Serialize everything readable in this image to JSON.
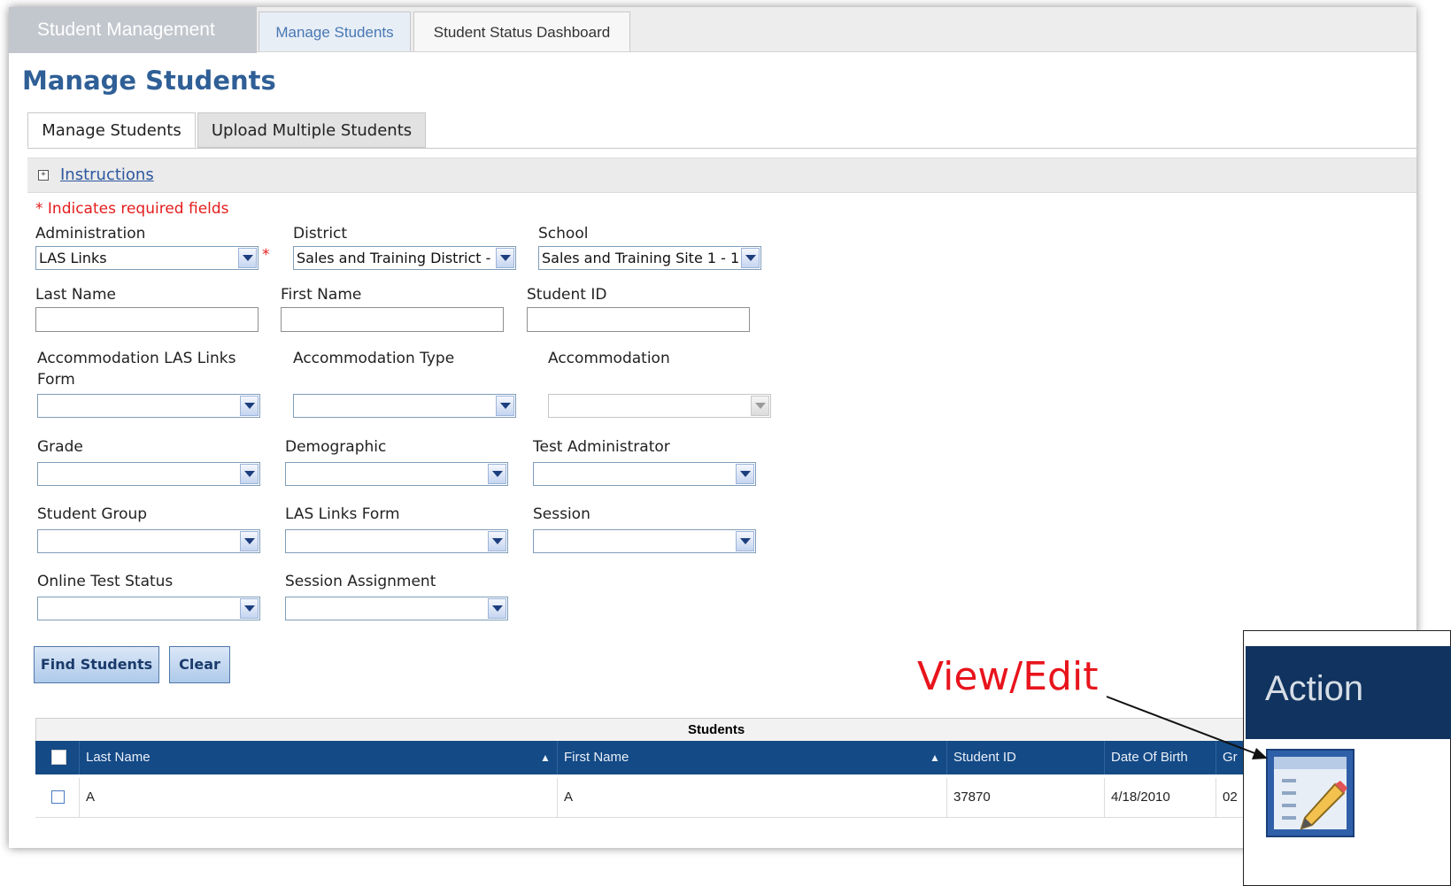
{
  "topnav": {
    "brand": "Student Management",
    "tabs": [
      {
        "label": "Manage Students",
        "active": true
      },
      {
        "label": "Student Status Dashboard",
        "active": false
      }
    ]
  },
  "page_title": "Manage Students",
  "subtabs": [
    {
      "label": "Manage Students",
      "active": true
    },
    {
      "label": "Upload Multiple Students",
      "active": false
    }
  ],
  "instructions_link": "Instructions",
  "required_note": "* Indicates required fields",
  "required_marker": "*",
  "filters": {
    "administration": {
      "label": "Administration",
      "value": "LAS Links"
    },
    "district": {
      "label": "District",
      "value": "Sales and Training District -"
    },
    "school": {
      "label": "School",
      "value": "Sales and Training Site 1 - 1"
    },
    "last_name": {
      "label": "Last Name",
      "value": ""
    },
    "first_name": {
      "label": "First Name",
      "value": ""
    },
    "student_id": {
      "label": "Student ID",
      "value": ""
    },
    "accommodation_form": {
      "label": "Accommodation LAS Links Form",
      "value": ""
    },
    "accommodation_type": {
      "label": "Accommodation Type",
      "value": ""
    },
    "accommodation": {
      "label": "Accommodation",
      "value": ""
    },
    "grade": {
      "label": "Grade",
      "value": ""
    },
    "demographic": {
      "label": "Demographic",
      "value": ""
    },
    "test_administrator": {
      "label": "Test Administrator",
      "value": ""
    },
    "student_group": {
      "label": "Student Group",
      "value": ""
    },
    "las_links_form": {
      "label": "LAS Links Form",
      "value": ""
    },
    "session": {
      "label": "Session",
      "value": ""
    },
    "online_test_status": {
      "label": "Online Test Status",
      "value": ""
    },
    "session_assignment": {
      "label": "Session Assignment",
      "value": ""
    }
  },
  "buttons": {
    "find": "Find Students",
    "clear": "Clear"
  },
  "grid": {
    "title": "Students",
    "columns": [
      "Last Name",
      "First Name",
      "Student ID",
      "Date Of Birth",
      "Gr"
    ],
    "rows": [
      {
        "last_name": "A",
        "first_name": "A",
        "student_id": "37870",
        "dob": "4/18/2010",
        "grade": "02"
      }
    ]
  },
  "callout": {
    "text": "View/Edit",
    "action_header": "Action",
    "icon": "edit-icon"
  },
  "colors": {
    "title_blue": "#2f5f96",
    "grid_header": "#144a86",
    "required_red": "#e41c1c",
    "callout_red": "#e8141c",
    "action_header": "#10335f"
  }
}
